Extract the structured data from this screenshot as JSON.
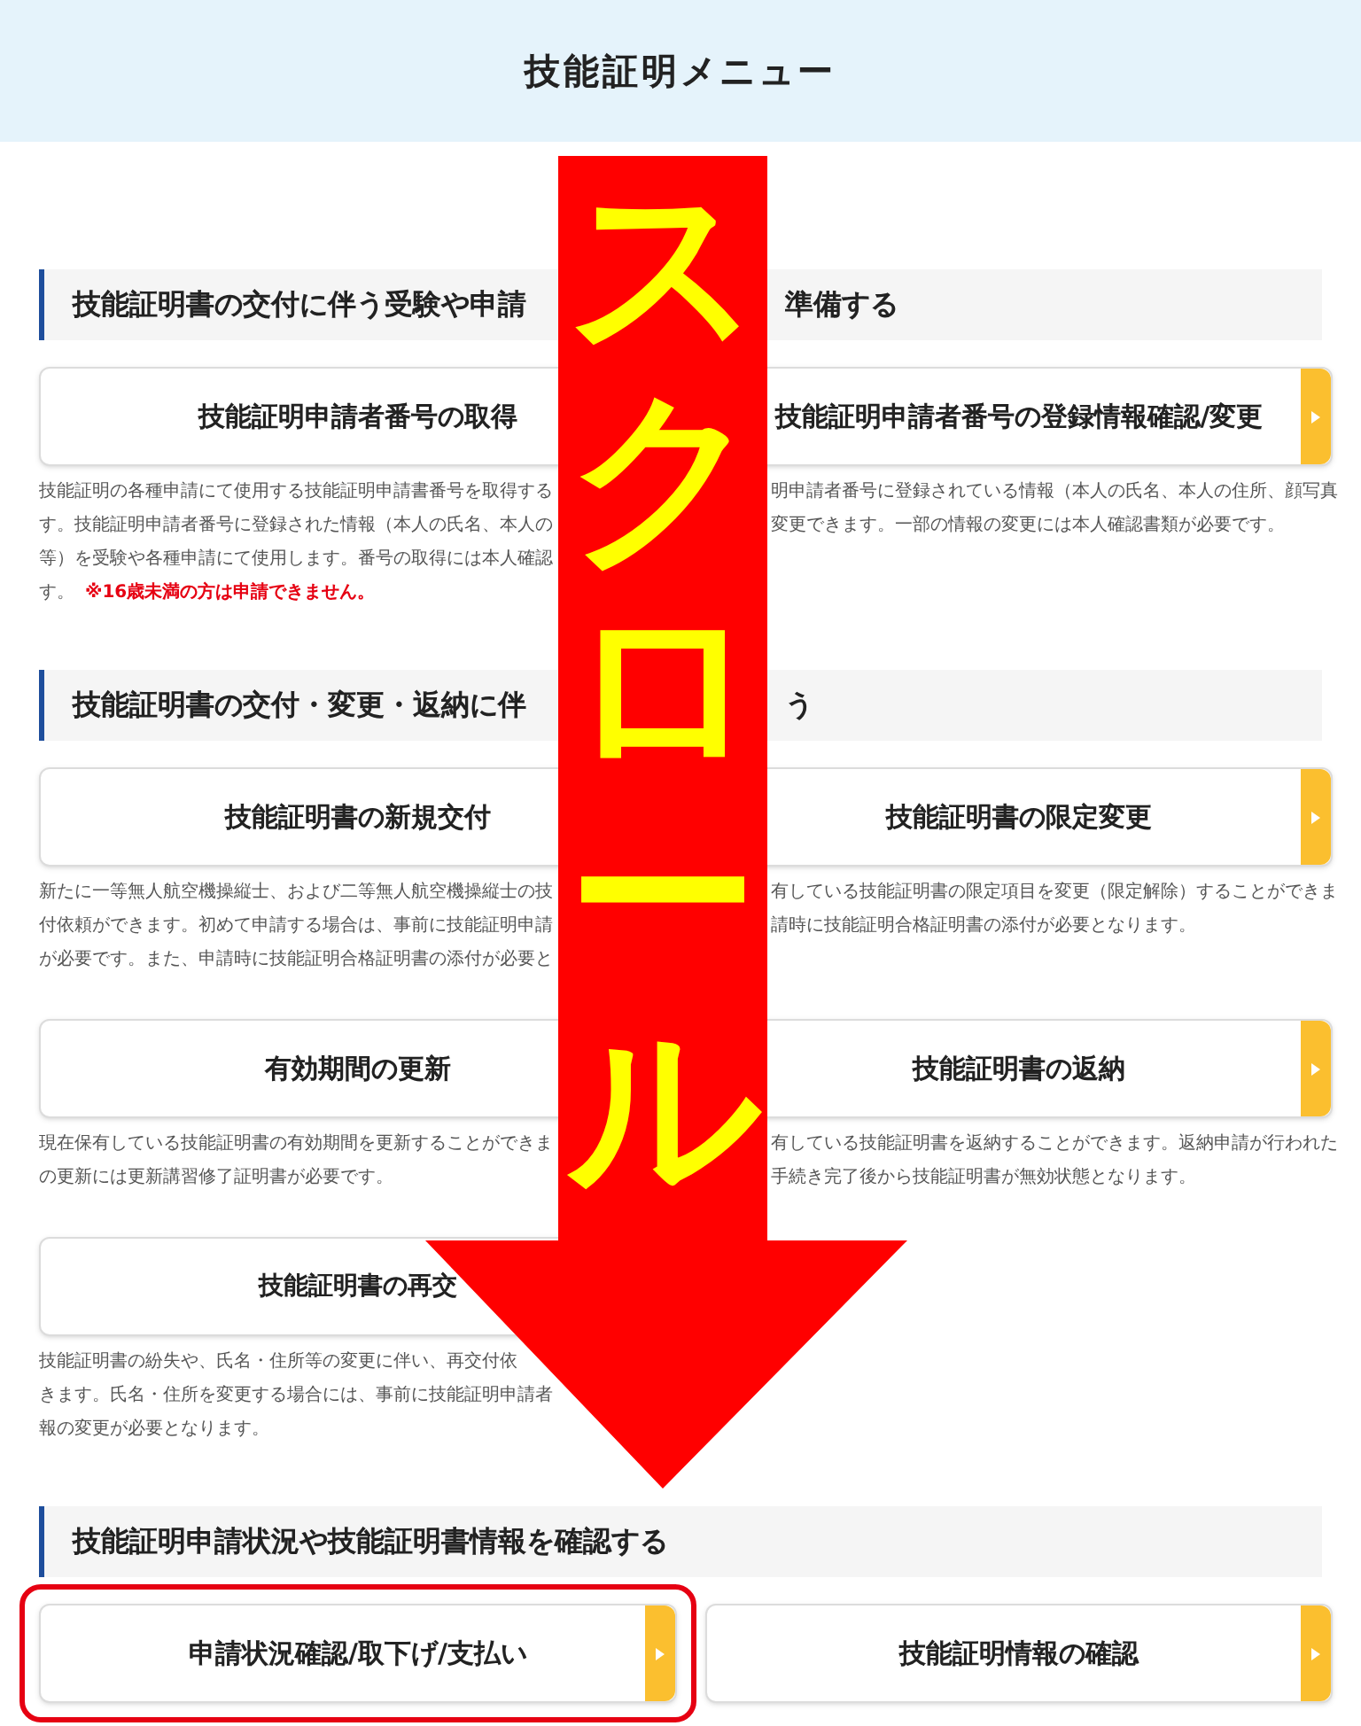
{
  "header": {
    "title": "技能証明メニュー"
  },
  "sections": [
    {
      "heading": "技能証明書の交付に伴う受験や申請",
      "heading_tail": "準備する",
      "rows": [
        {
          "cards": [
            {
              "title": "技能証明申請者番号の取得",
              "highlighted": false,
              "description": [
                "技能証明の各種申請にて使用する技能証明申請書番号を取得する",
                "す。技能証明申請者番号に登録された情報（本人の氏名、本人の",
                "等）を受験や各種申請にて使用します。番号の取得には本人確認",
                "す。"
              ],
              "note": "※16歳未満の方は申請できません。"
            },
            {
              "title": "技能証明申請者番号の登録情報確認/変更",
              "highlighted": false,
              "description": [
                "明申請者番号に登録されている情報（本人の氏名、本人の住所、顔写真",
                "変更できます。一部の情報の変更には本人確認書類が必要です。"
              ]
            }
          ]
        }
      ]
    },
    {
      "heading": "技能証明書の交付・変更・返納に伴",
      "heading_tail": "う",
      "rows": [
        {
          "cards": [
            {
              "title": "技能証明書の新規交付",
              "highlighted": false,
              "description": [
                "新たに一等無人航空機操縦士、および二等無人航空機操縦士の技",
                "付依頼ができます。初めて申請する場合は、事前に技能証明申請",
                "が必要です。また、申請時に技能証明合格証明書の添付が必要と"
              ]
            },
            {
              "title": "技能証明書の限定変更",
              "highlighted": false,
              "description": [
                "有している技能証明書の限定項目を変更（限定解除）することができま",
                "請時に技能証明合格証明書の添付が必要となります。"
              ]
            }
          ]
        },
        {
          "cards": [
            {
              "title": "有効期間の更新",
              "highlighted": false,
              "description": [
                "現在保有している技能証明書の有効期間を更新することができま",
                "の更新には更新講習修了証明書が必要です。"
              ]
            },
            {
              "title": "技能証明書の返納",
              "highlighted": false,
              "description": [
                "有している技能証明書を返納することができます。返納申請が行われた",
                "手続き完了後から技能証明書が無効状態となります。"
              ]
            }
          ]
        },
        {
          "cards": [
            {
              "title": "技能証明書の再交",
              "highlighted": false,
              "description": [
                "技能証明書の紛失や、氏名・住所等の変更に伴い、再交付依",
                "きます。氏名・住所を変更する場合には、事前に技能証明申請者",
                "報の変更が必要となります。"
              ]
            }
          ]
        }
      ]
    },
    {
      "heading": "技能証明申請状況や技能証明書情報を確認する",
      "rows": [
        {
          "cards": [
            {
              "title": "申請状況確認/取下げ/支払い",
              "highlighted": true
            },
            {
              "title": "技能証明情報の確認",
              "highlighted": false
            }
          ]
        }
      ]
    }
  ],
  "overlay": {
    "label": "スクロール"
  }
}
